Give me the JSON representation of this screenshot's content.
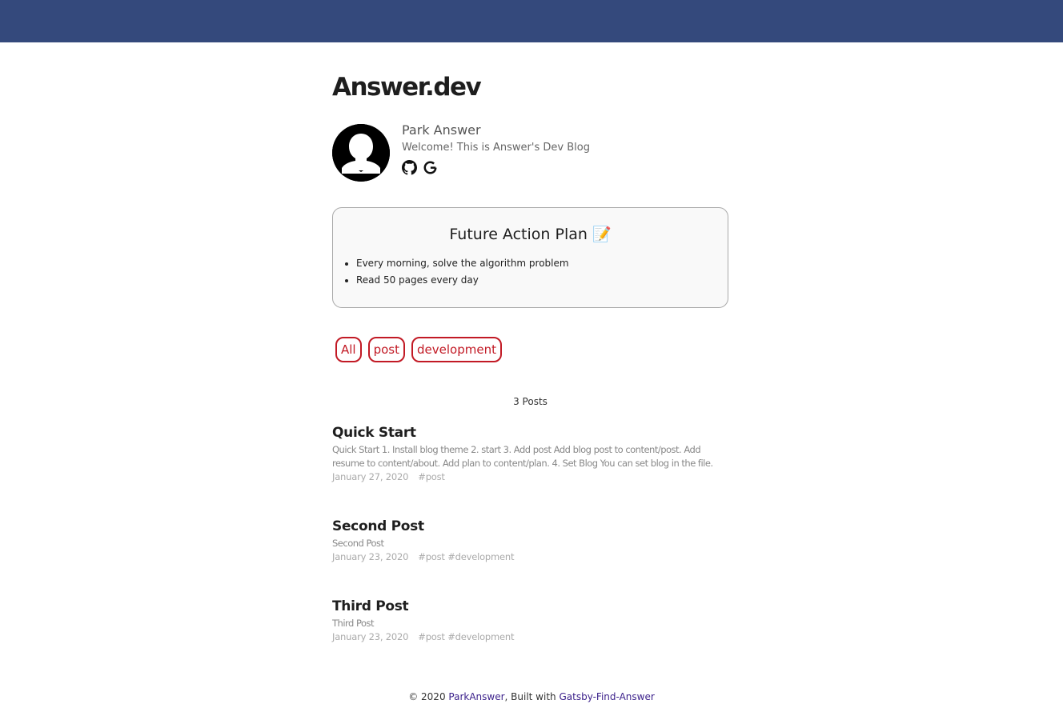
{
  "site": {
    "title": "Answer.dev"
  },
  "bio": {
    "name": "Park Answer",
    "description": "Welcome! This is Answer's Dev Blog",
    "social_icons": [
      "github-icon",
      "google-icon"
    ]
  },
  "plan": {
    "title": "Future Action Plan 📝",
    "items": [
      "Every morning, solve the algorithm problem",
      "Read 50 pages every day"
    ]
  },
  "tags": [
    "All",
    "post",
    "development"
  ],
  "post_count": "3 Posts",
  "posts": [
    {
      "title": "Quick Start",
      "excerpt": "Quick Start 1. Install blog theme 2. start 3. Add post Add blog post to content/post. Add resume to content/about. Add plan to content/plan. 4. Set Blog You can set blog in the file.",
      "date": "January 27, 2020",
      "tags": "#post"
    },
    {
      "title": "Second Post",
      "excerpt": "Second Post",
      "date": "January 23, 2020",
      "tags": "#post #development"
    },
    {
      "title": "Third Post",
      "excerpt": "Third Post",
      "date": "January 23, 2020",
      "tags": "#post #development"
    }
  ],
  "footer": {
    "prefix": "© 2020 ",
    "author_link": "ParkAnswer",
    "middle": ", Built with ",
    "theme_link": "Gatsby-Find-Answer"
  },
  "colors": {
    "topbar": "#34497c",
    "tag_accent": "#c21a25",
    "link": "#3a1f8a"
  }
}
